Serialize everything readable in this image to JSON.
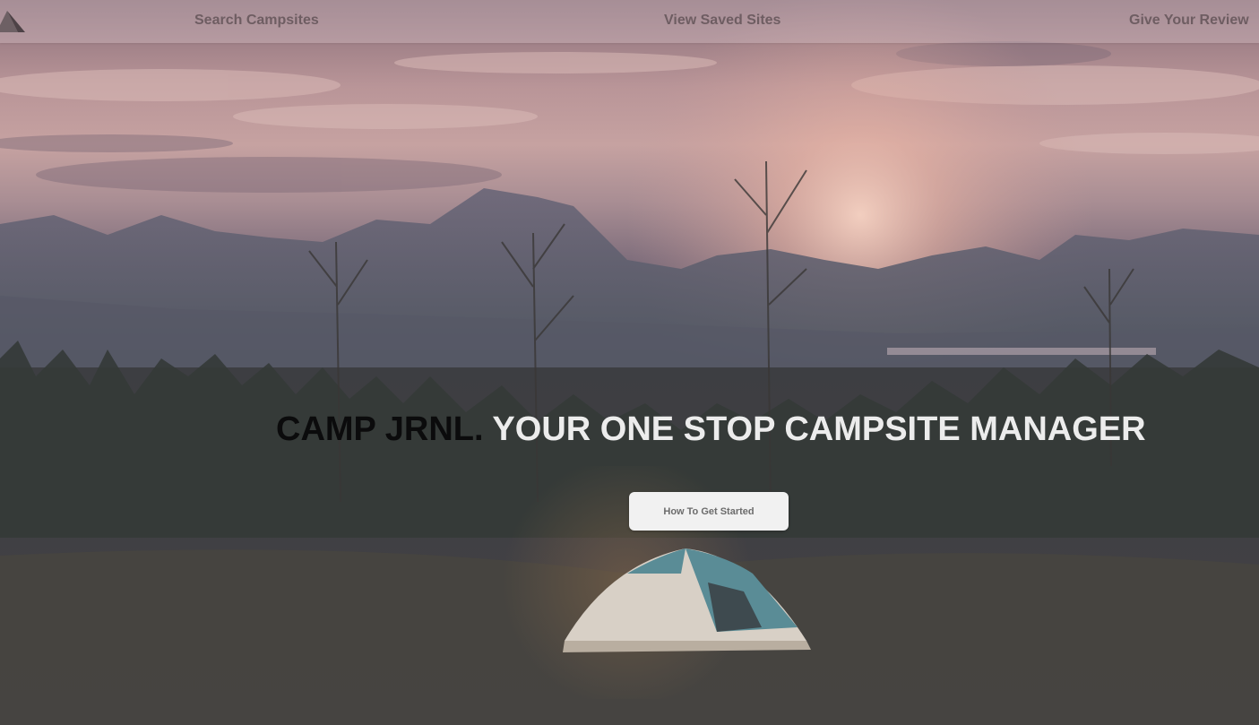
{
  "nav": {
    "logo_icon": "tent-logo-icon",
    "links": [
      {
        "label": "Search Campsites"
      },
      {
        "label": "View Saved Sites"
      },
      {
        "label": "Give Your Review"
      }
    ]
  },
  "hero": {
    "brand": "CAMP JRNL.",
    "tagline": "YOUR ONE STOP CAMPSITE MANAGER",
    "cta_label": "How To Get Started",
    "background_icon": "sunset-mountains-tent-photo"
  },
  "colors": {
    "brand_text": "#0b0b0c",
    "tagline_text": "#ececec",
    "nav_text": "#6e5d62",
    "button_bg": "#f1f1f1"
  }
}
